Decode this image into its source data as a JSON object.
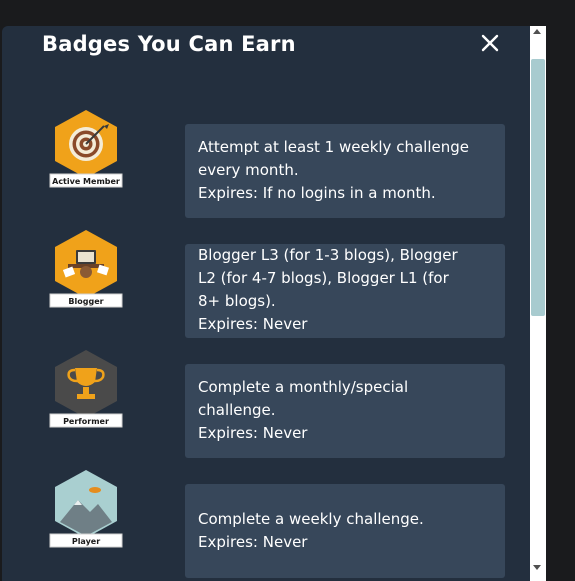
{
  "modal": {
    "title": "Badges You Can Earn",
    "close_icon": "close-icon"
  },
  "badges": [
    {
      "name": "Active Member",
      "icon": "target-icon",
      "hex_color": "#f0a21a",
      "lines": [
        "Attempt at least 1 weekly challenge",
        "every month.",
        "Expires: If no logins in a month."
      ]
    },
    {
      "name": "Blogger",
      "icon": "blogger-desk-icon",
      "hex_color": "#f0a21a",
      "lines": [
        "Blogger L3 (for 1-3 blogs), Blogger",
        "L2 (for 4-7 blogs), Blogger L1 (for",
        "8+ blogs).",
        "Expires: Never"
      ]
    },
    {
      "name": "Performer",
      "icon": "trophy-icon",
      "hex_color": "#4a4a4a",
      "lines": [
        "Complete a monthly/special",
        "challenge.",
        "Expires: Never"
      ]
    },
    {
      "name": "Player",
      "icon": "mountain-icon",
      "hex_color": "#a9cfd0",
      "lines": [
        "Complete a weekly challenge.",
        "Expires: Never"
      ]
    }
  ],
  "colors": {
    "modal_bg": "#232f3e",
    "card_bg": "#37475a",
    "scroll_thumb": "#a8cbcf",
    "accent_orange": "#f0a21a"
  }
}
